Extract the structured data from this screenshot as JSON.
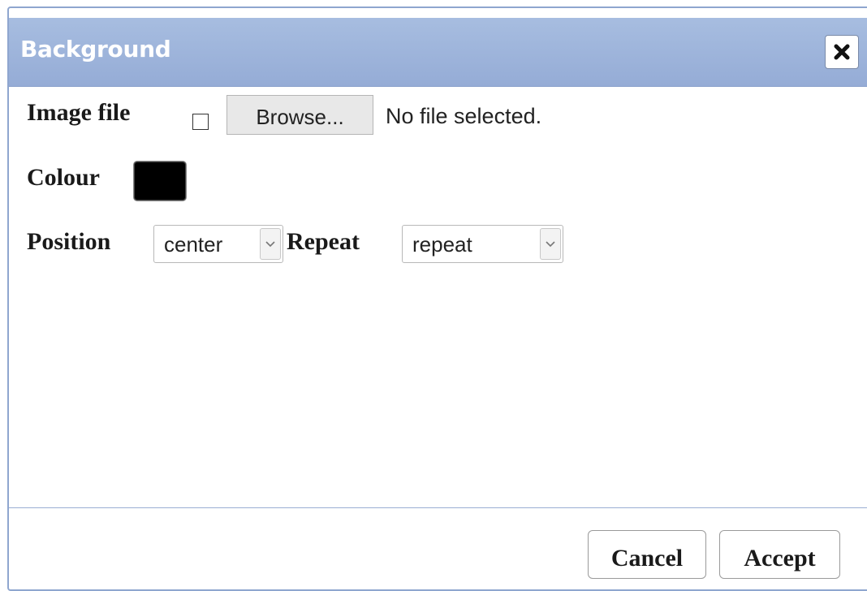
{
  "dialog": {
    "title": "Background",
    "close_icon": "close-icon"
  },
  "form": {
    "image_file_label": "Image file",
    "image_file_checked": false,
    "browse_label": "Browse...",
    "file_status": "No file selected.",
    "colour_label": "Colour",
    "colour_value": "#000000",
    "position_label": "Position",
    "position_value": "center",
    "repeat_label": "Repeat",
    "repeat_value": "repeat"
  },
  "footer": {
    "cancel_label": "Cancel",
    "accept_label": "Accept"
  },
  "colors": {
    "titlebar": "#9cb3da",
    "border": "#8fa6cf"
  }
}
